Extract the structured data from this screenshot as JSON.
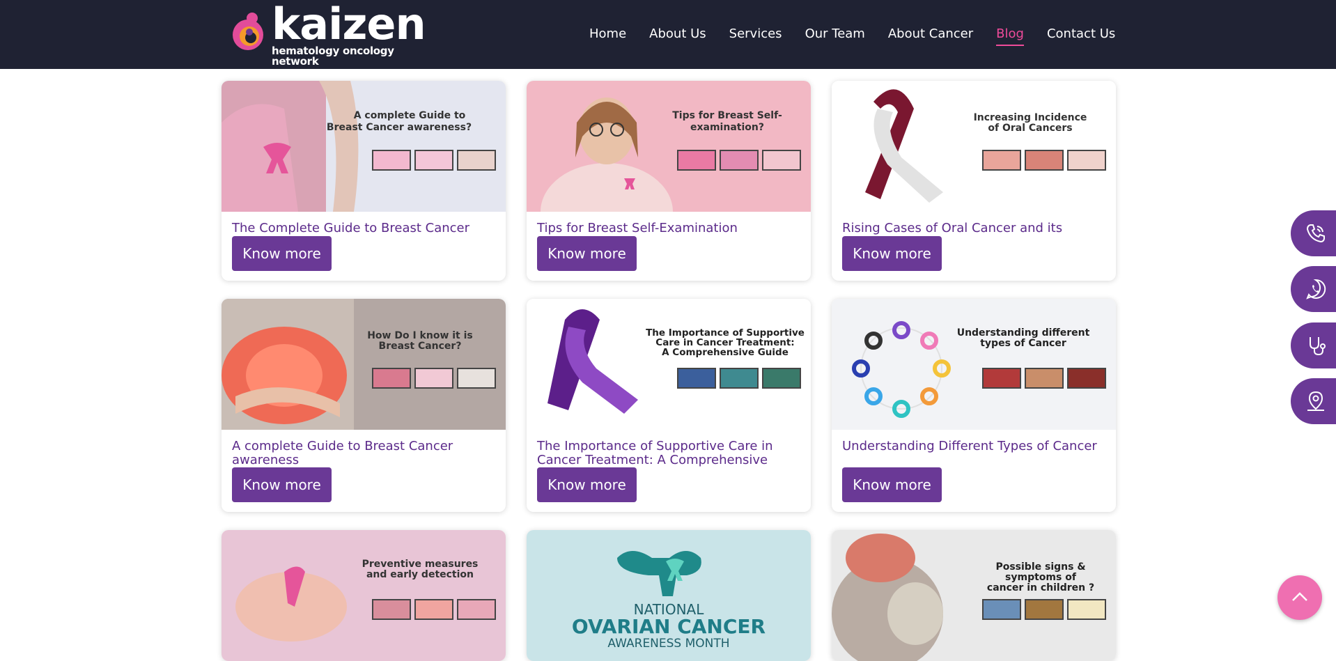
{
  "brand": {
    "name": "kaizen",
    "tagline": "hematology oncology network"
  },
  "nav": {
    "items": [
      "Home",
      "About Us",
      "Services",
      "Our Team",
      "About Cancer",
      "Blog",
      "Contact Us"
    ],
    "active": "Blog"
  },
  "posts": [
    {
      "image_text": [
        "A complete Guide to",
        "Breast Cancer awareness?"
      ],
      "title": "The Complete Guide to Breast Cancer",
      "button": "Know more"
    },
    {
      "image_text": [
        "Tips for Breast Self-",
        "examination?"
      ],
      "title": "Tips for Breast Self-Examination",
      "button": "Know more"
    },
    {
      "image_text": [
        "Increasing Incidence",
        "of Oral Cancers"
      ],
      "title": "Rising Cases of Oral Cancer and its Causes",
      "button": "Know more"
    },
    {
      "image_text": [
        "How Do I know it is",
        "Breast Cancer?"
      ],
      "title": "A complete Guide to Breast Cancer awareness",
      "button": "Know more"
    },
    {
      "image_text": [
        "The Importance of Supportive",
        "Care in Cancer Treatment:",
        "A Comprehensive Guide"
      ],
      "title": "The Importance of Supportive Care in Cancer Treatment: A Comprehensive Guide",
      "button": "Know more"
    },
    {
      "image_text": [
        "Understanding different",
        "types of Cancer"
      ],
      "title": "Understanding Different Types of Cancer",
      "button": "Know more"
    },
    {
      "image_text": [
        "Preventive measures",
        "and early detection"
      ]
    },
    {
      "image_text": [
        "NATIONAL",
        "OVARIAN CANCER",
        "AWARENESS MONTH"
      ]
    },
    {
      "image_text": [
        "Possible signs &",
        "symptoms of",
        "cancer in children ?"
      ]
    }
  ],
  "floating_actions": [
    "phone-icon",
    "whatsapp-icon",
    "stethoscope-icon",
    "location-icon"
  ],
  "scroll_top": "chevron-up-icon",
  "colors": {
    "header": "#1f2233",
    "accent": "#ef4b9a",
    "button": "#6a3996",
    "title": "#5b2a8a"
  }
}
